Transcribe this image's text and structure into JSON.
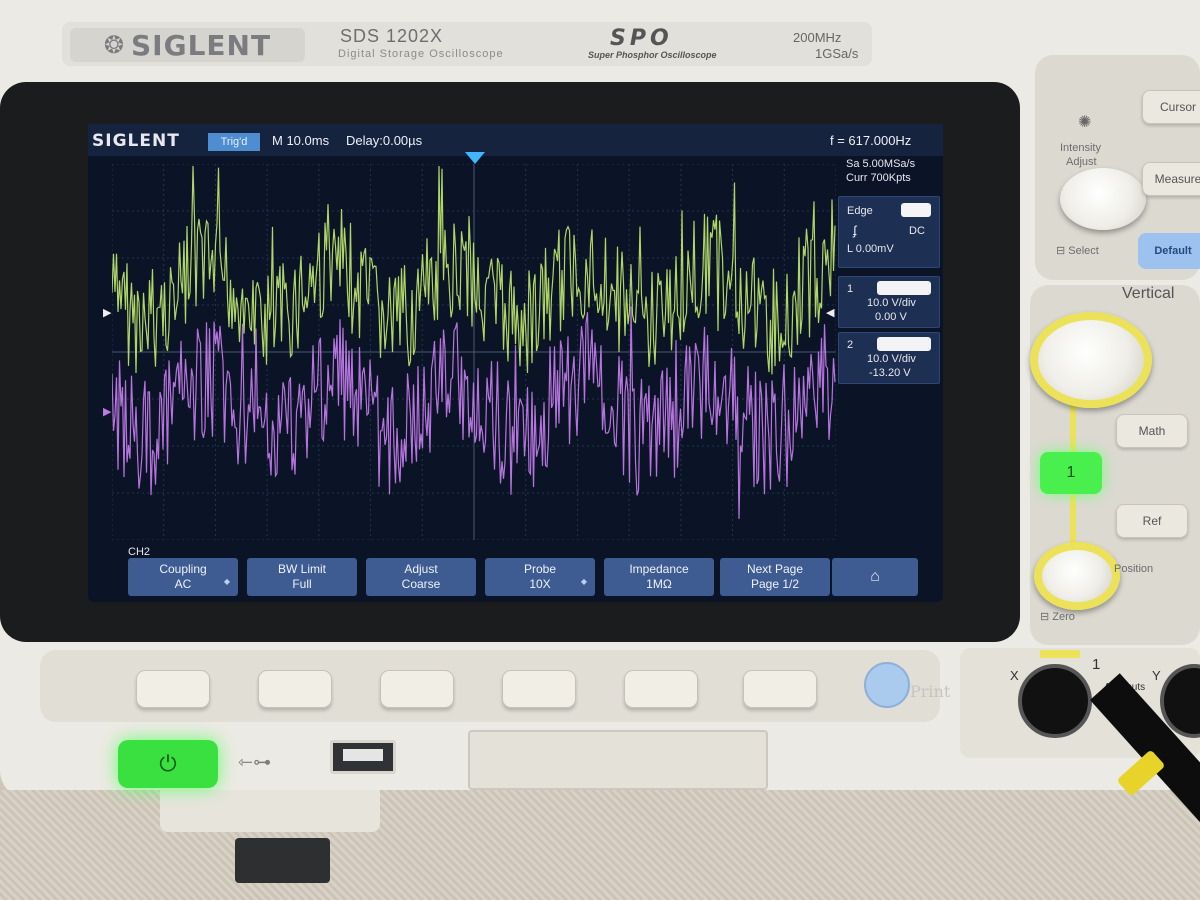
{
  "brand": {
    "logo": "SIGLENT",
    "model": "SDS 1202X",
    "model_subtitle": "Digital Storage Oscilloscope",
    "spo": "SPO",
    "spo_subtitle": "Super Phosphor Oscilloscope",
    "bandwidth": "200MHz",
    "sample_rate": "1GSa/s"
  },
  "screen": {
    "logo": "SIGLENT",
    "trigger_state": "Trig'd",
    "timebase": "M 10.0ms",
    "delay": "Delay:0.00µs",
    "frequency": "f = 617.000Hz",
    "sa_rate": "Sa 5.00MSa/s",
    "curr_points": "Curr 700Kpts",
    "trigger": {
      "type": "Edge",
      "coupling": "DC",
      "level": "L  0.00mV"
    },
    "channels": [
      {
        "number": "1",
        "scale": "10.0 V/div",
        "offset": "0.00 V",
        "color": "#b8e06a"
      },
      {
        "number": "2",
        "scale": "10.0 V/div",
        "offset": "-13.20 V",
        "color": "#c07ae8"
      }
    ],
    "menu_channel": "CH2",
    "softkeys": [
      {
        "line1": "Coupling",
        "line2": "AC",
        "arrow": true
      },
      {
        "line1": "BW Limit",
        "line2": "Full",
        "arrow": false
      },
      {
        "line1": "Adjust",
        "line2": "Coarse",
        "arrow": false
      },
      {
        "line1": "Probe",
        "line2": "10X",
        "arrow": true
      },
      {
        "line1": "Impedance",
        "line2": "1MΩ",
        "arrow": false
      },
      {
        "line1": "Next Page",
        "line2": "Page 1/2",
        "arrow": false
      }
    ]
  },
  "front_panel": {
    "print_label": "Print",
    "intensity_label": "Intensity",
    "adjust_label": "Adjust",
    "select_label": "Select",
    "cursors_label": "Cursor",
    "measure_label": "Measure",
    "default_label": "Default",
    "vertical_label": "Vertical",
    "math_label": "Math",
    "ref_label": "Ref",
    "ch1_label": "1",
    "position_label": "Position",
    "zero_label": "Zero",
    "input_label": "1",
    "x_label": "X",
    "y_label": "Y",
    "all_inputs_label": "All Inputs"
  }
}
